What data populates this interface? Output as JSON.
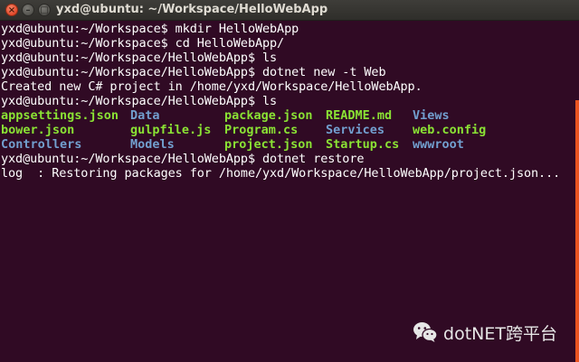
{
  "window": {
    "title": "yxd@ubuntu: ~/Workspace/HelloWebApp",
    "close_glyph": "×",
    "min_glyph": "–",
    "max_glyph": "□"
  },
  "colors": {
    "background": "#300a24",
    "text": "#ffffff",
    "file": "#8ae234",
    "directory": "#729fcf",
    "scrollbar": "#e95420"
  },
  "terminal": {
    "lines_before": [
      "yxd@ubuntu:~/Workspace$ mkdir HelloWebApp",
      "yxd@ubuntu:~/Workspace$ cd HelloWebApp/",
      "yxd@ubuntu:~/Workspace/HelloWebApp$ ls",
      "yxd@ubuntu:~/Workspace/HelloWebApp$ dotnet new -t Web",
      "Created new C# project in /home/yxd/Workspace/HelloWebApp.",
      "yxd@ubuntu:~/Workspace/HelloWebApp$ ls"
    ],
    "ls_rows": [
      [
        {
          "name": "appsettings.json",
          "kind": "file"
        },
        {
          "name": "Data",
          "kind": "dir"
        },
        {
          "name": "package.json",
          "kind": "file"
        },
        {
          "name": "README.md",
          "kind": "file"
        },
        {
          "name": "Views",
          "kind": "dir"
        }
      ],
      [
        {
          "name": "bower.json",
          "kind": "file"
        },
        {
          "name": "gulpfile.js",
          "kind": "file"
        },
        {
          "name": "Program.cs",
          "kind": "file"
        },
        {
          "name": "Services",
          "kind": "dir"
        },
        {
          "name": "web.config",
          "kind": "file"
        }
      ],
      [
        {
          "name": "Controllers",
          "kind": "dir"
        },
        {
          "name": "Models",
          "kind": "dir"
        },
        {
          "name": "project.json",
          "kind": "file"
        },
        {
          "name": "Startup.cs",
          "kind": "file"
        },
        {
          "name": "wwwroot",
          "kind": "dir"
        }
      ]
    ],
    "lines_after": [
      "yxd@ubuntu:~/Workspace/HelloWebApp$ dotnet restore",
      "log  : Restoring packages for /home/yxd/Workspace/HelloWebApp/project.json..."
    ]
  },
  "watermark": {
    "icon": "wechat-icon",
    "text": "dotNET跨平台"
  }
}
